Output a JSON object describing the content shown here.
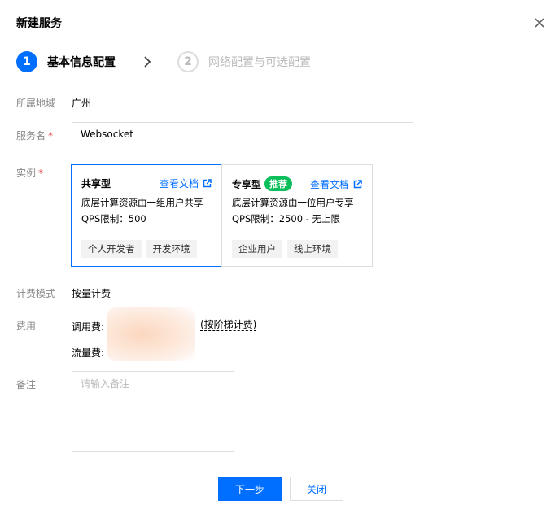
{
  "dialog": {
    "title": "新建服务"
  },
  "steps": [
    {
      "num": "1",
      "label": "基本信息配置"
    },
    {
      "num": "2",
      "label": "网络配置与可选配置"
    }
  ],
  "form": {
    "region": {
      "label": "所属地域",
      "value": "广州"
    },
    "service_name": {
      "label": "服务名",
      "required": "*",
      "value": "Websocket"
    },
    "instance": {
      "label": "实例",
      "required": "*",
      "cards": [
        {
          "name": "共享型",
          "badge": "",
          "doc_link": "查看文档",
          "desc": "底层计算资源由一组用户共享",
          "qps": "QPS限制：500",
          "tags": [
            "个人开发者",
            "开发环境"
          ]
        },
        {
          "name": "专享型",
          "badge": "推荐",
          "doc_link": "查看文档",
          "desc": "底层计算资源由一位用户专享",
          "qps": "QPS限制：2500 - 无上限",
          "tags": [
            "企业用户",
            "线上环境"
          ]
        }
      ]
    },
    "billing_mode": {
      "label": "计费模式",
      "value": "按量计费"
    },
    "fee": {
      "label": "费用",
      "call_fee_label": "调用费:",
      "traffic_fee_label": "流量费:",
      "tier_link": "(按阶梯计费)"
    },
    "remark": {
      "label": "备注",
      "placeholder": "请输入备注"
    }
  },
  "footer": {
    "next_label": "下一步",
    "close_label": "关闭"
  },
  "colors": {
    "accent": "#006eff",
    "badge": "#0abf5b",
    "required": "#e54545"
  }
}
